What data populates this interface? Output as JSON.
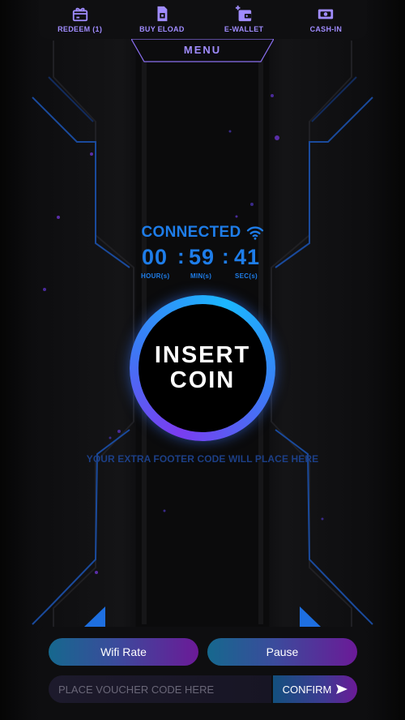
{
  "nav": {
    "items": [
      {
        "label": "REDEEM (1)",
        "icon": "gift-card-icon"
      },
      {
        "label": "BUY ELOAD",
        "icon": "sim-card-icon"
      },
      {
        "label": "E-WALLET",
        "icon": "wallet-icon"
      },
      {
        "label": "CASH-IN",
        "icon": "cash-icon"
      }
    ],
    "menu_label": "MENU"
  },
  "status": {
    "connection": "CONNECTED",
    "timer": {
      "hours": "00",
      "minutes": "59",
      "seconds": "41",
      "separator": ":",
      "hours_label": "HOUR(s)",
      "minutes_label": "MIN(s)",
      "seconds_label": "SEC(s)"
    }
  },
  "coin": {
    "line1": "INSERT",
    "line2": "COIN"
  },
  "footer_code": "YOUR EXTRA FOOTER CODE WILL PLACE HERE",
  "actions": {
    "wifi_rate": "Wifi Rate",
    "pause": "Pause",
    "voucher_placeholder": "PLACE VOUCHER CODE HERE",
    "voucher_value": "",
    "confirm": "CONFIRM"
  },
  "colors": {
    "accent_blue": "#1e7de9",
    "accent_purple": "#a08cff",
    "button_gradient_start": "#16688e",
    "button_gradient_end": "#6b1a97"
  }
}
